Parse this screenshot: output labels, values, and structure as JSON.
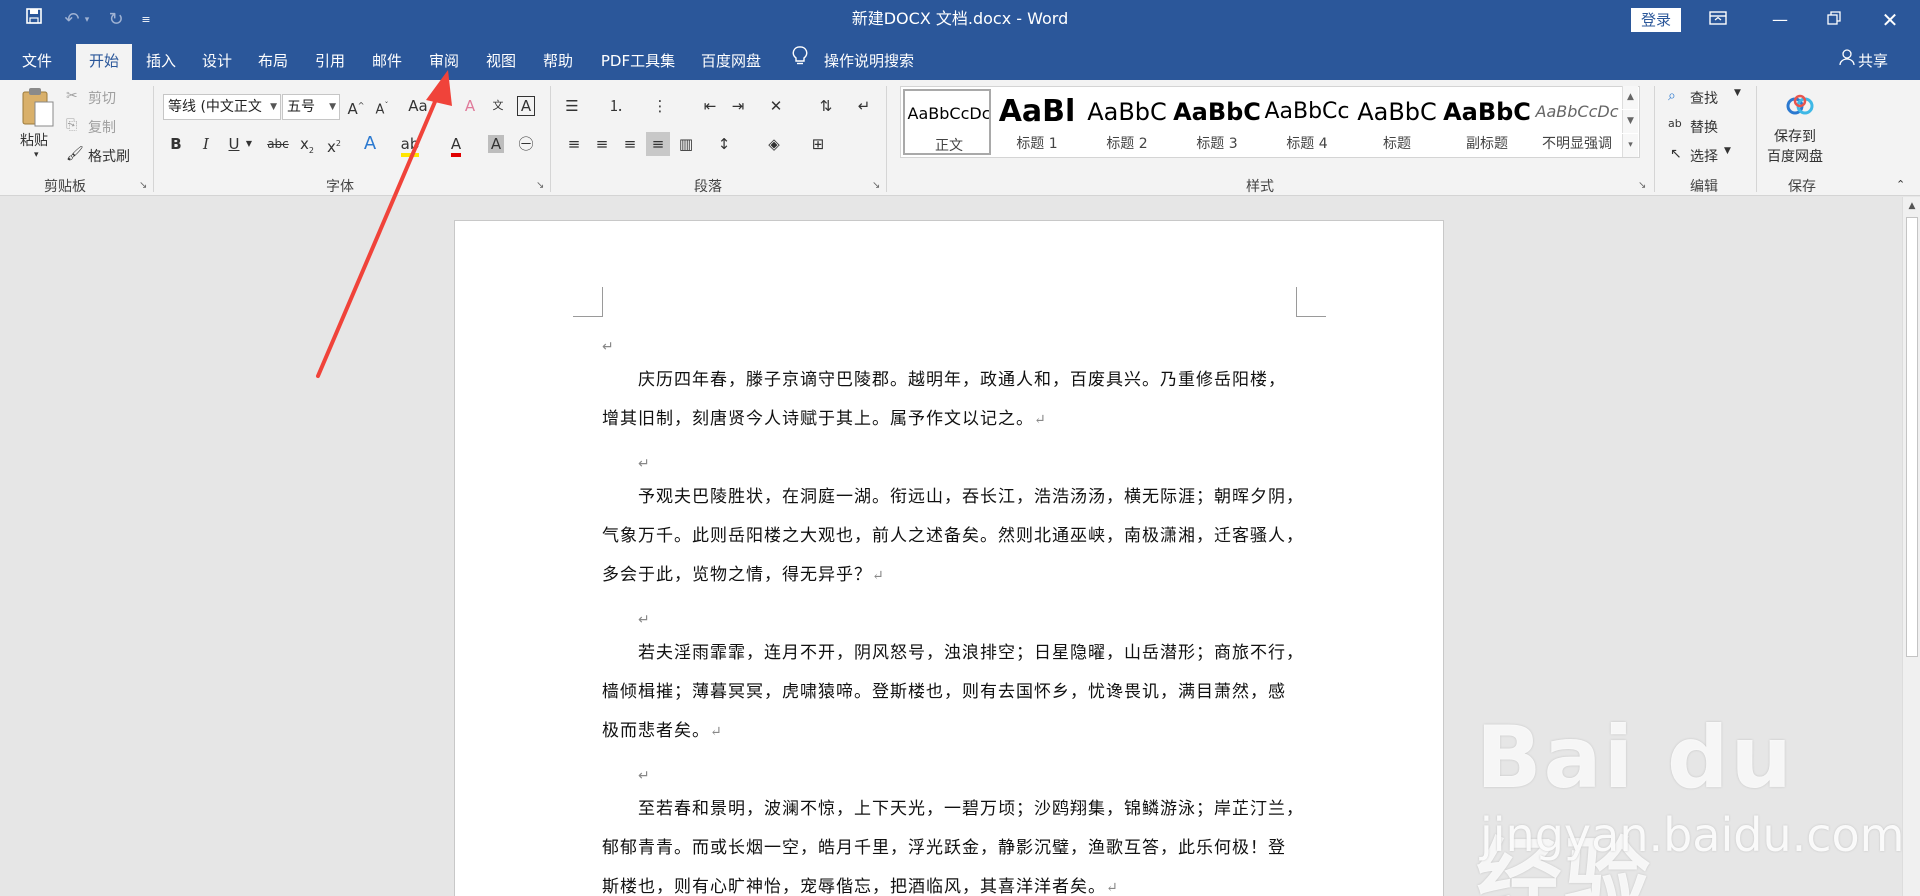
{
  "titlebar": {
    "title": "新建DOCX 文档.docx  -  Word",
    "login": "登录",
    "save_icon": "save-icon",
    "undo_icon": "undo-icon",
    "redo_icon": "redo-icon"
  },
  "tabs": [
    {
      "label": "文件"
    },
    {
      "label": "开始"
    },
    {
      "label": "插入"
    },
    {
      "label": "设计"
    },
    {
      "label": "布局"
    },
    {
      "label": "引用"
    },
    {
      "label": "邮件"
    },
    {
      "label": "审阅"
    },
    {
      "label": "视图"
    },
    {
      "label": "帮助"
    },
    {
      "label": "PDF工具集"
    },
    {
      "label": "百度网盘"
    }
  ],
  "active_tab": "开始",
  "tell_me": "操作说明搜索",
  "share": "共享",
  "ribbon": {
    "clipboard": {
      "paste": "粘贴",
      "cut": "剪切",
      "copy": "复制",
      "format_painter": "格式刷",
      "label": "剪贴板"
    },
    "font": {
      "font_name": "等线 (中文正文",
      "font_size": "五号",
      "label": "字体"
    },
    "paragraph": {
      "label": "段落"
    },
    "styles": {
      "label": "样式",
      "items": [
        {
          "preview": "AaBbCcDc",
          "name": "正文"
        },
        {
          "preview": "AaBl",
          "name": "标题 1"
        },
        {
          "preview": "AaBbC",
          "name": "标题 2"
        },
        {
          "preview": "AaBbC",
          "name": "标题 3"
        },
        {
          "preview": "AaBbCc",
          "name": "标题 4"
        },
        {
          "preview": "AaBbC",
          "name": "标题"
        },
        {
          "preview": "AaBbC",
          "name": "副标题"
        },
        {
          "preview": "AaBbCcDc",
          "name": "不明显强调"
        }
      ]
    },
    "editing": {
      "find": "查找",
      "replace": "替换",
      "select": "选择",
      "label": "编辑"
    },
    "save": {
      "line1": "保存到",
      "line2": "百度网盘",
      "label": "保存"
    }
  },
  "document": {
    "paragraphs": [
      [
        "庆历四年春，滕子京谪守巴陵郡。越明年，政通人和，百废具兴。乃重修岳阳楼，",
        "增其旧制，刻唐贤今人诗赋于其上。属予作文以记之。"
      ],
      [
        "予观夫巴陵胜状，在洞庭一湖。衔远山，吞长江，浩浩汤汤，横无际涯；朝晖夕阴，",
        "气象万千。此则岳阳楼之大观也，前人之述备矣。然则北通巫峡，南极潇湘，迁客骚人，",
        "多会于此，览物之情，得无异乎？"
      ],
      [
        "若夫淫雨霏霏，连月不开，阴风怒号，浊浪排空；日星隐曜，山岳潜形；商旅不行，",
        "樯倾楫摧；薄暮冥冥，虎啸猿啼。登斯楼也，则有去国怀乡，忧谗畏讥，满目萧然，感",
        "极而悲者矣。"
      ],
      [
        "至若春和景明，波澜不惊，上下天光，一碧万顷；沙鸥翔集，锦鳞游泳；岸芷汀兰，",
        "郁郁青青。而或长烟一空，皓月千里，浮光跃金，静影沉璧，渔歌互答，此乐何极！登",
        "斯楼也，则有心旷神怡，宠辱偕忘，把酒临风，其喜洋洋者矣。"
      ]
    ],
    "para_mark": "↵"
  },
  "watermark": {
    "brand": "Bai du 经验",
    "url": "jingyan.baidu.com"
  },
  "colors": {
    "accent": "#2b579a",
    "annotation_arrow": "#f0433a"
  }
}
